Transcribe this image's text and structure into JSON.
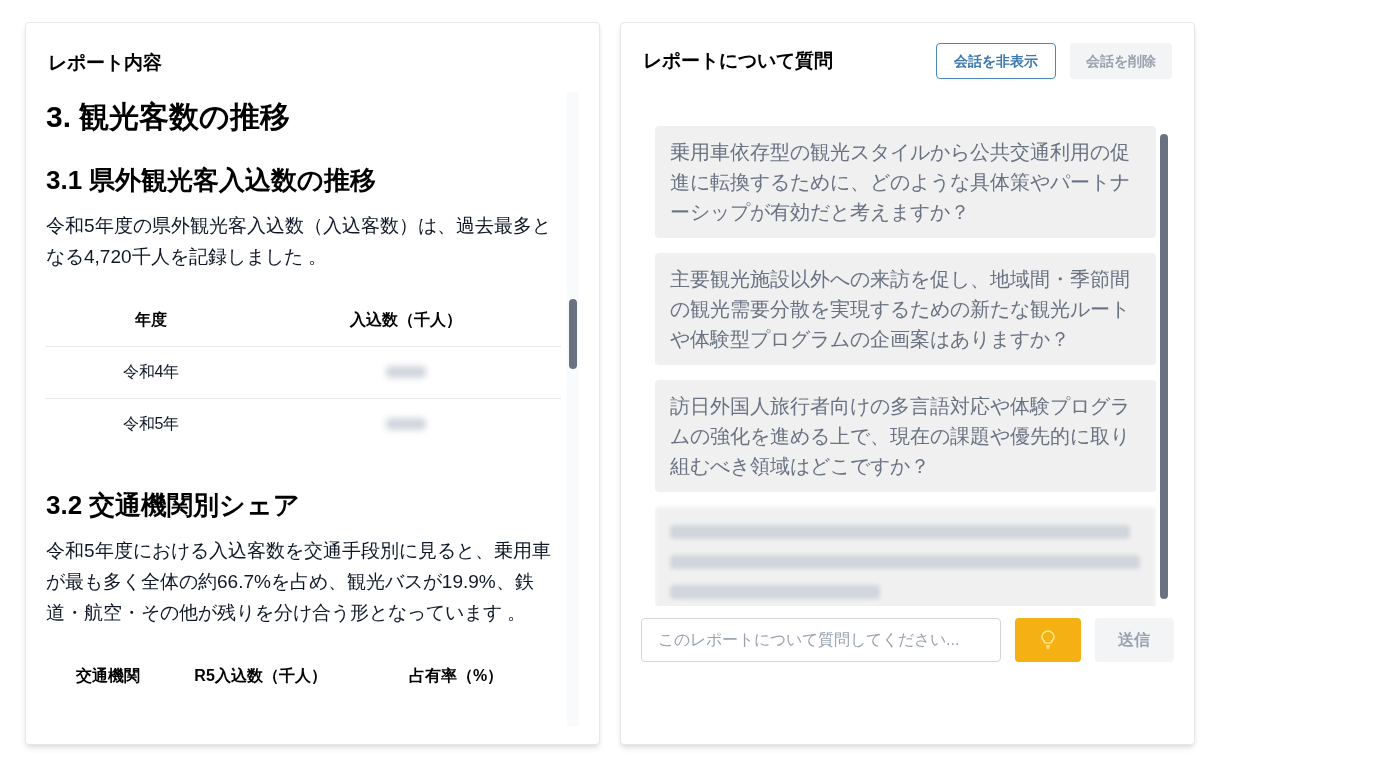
{
  "report_panel": {
    "title": "レポート内容",
    "sections": [
      {
        "kind": "h1",
        "text": "3. 観光客数の推移"
      },
      {
        "kind": "h2",
        "text": "3.1 県外観光客入込数の推移"
      },
      {
        "kind": "p",
        "text": "令和5年度の県外観光客入込数（入込客数）は、過去最多となる4,720千人を記録しました 。"
      },
      {
        "kind": "table",
        "columns": [
          "年度",
          "入込数（千人）"
        ],
        "rows": [
          {
            "cells": [
              "令和4年"
            ],
            "redacted": true
          },
          {
            "cells": [
              "令和5年"
            ],
            "redacted": true
          }
        ]
      },
      {
        "kind": "h2",
        "text": "3.2 交通機関別シェア"
      },
      {
        "kind": "p",
        "text": "令和5年度における入込客数を交通手段別に見ると、乗用車が最も多く全体の約66.7%を占め、観光バスが19.9%、鉄道・航空・その他が残りを分け合う形となっています 。"
      },
      {
        "kind": "table",
        "columns": [
          "交通機関",
          "R5入込数（千人）",
          "占有率（%）"
        ]
      }
    ]
  },
  "chat_panel": {
    "title": "レポートについて質問",
    "buttons": [
      {
        "label": "会話を非表示",
        "disabled": false
      },
      {
        "label": "会話を削除",
        "disabled": true
      }
    ],
    "suggestions": [
      {
        "text": "乗用車依存型の観光スタイルから公共交通利用の促進に転換するために、どのような具体策やパートナーシップが有効だと考えますか？",
        "redacted": false
      },
      {
        "text": "主要観光施設以外への来訪を促し、地域間・季節間の観光需要分散を実現するための新たな観光ルートや体験型プログラムの企画案はありますか？",
        "redacted": false
      },
      {
        "text": "訪日外国人旅行者向けの多言語対応や体験プログラムの強化を進める上で、現在の課題や優先的に取り組むべき領域はどこですか？",
        "redacted": false
      },
      {
        "redacted": true
      }
    ],
    "input": {
      "placeholder": "このレポートについて質問してください..."
    },
    "send_button": {
      "label": "送信",
      "disabled": true
    }
  }
}
